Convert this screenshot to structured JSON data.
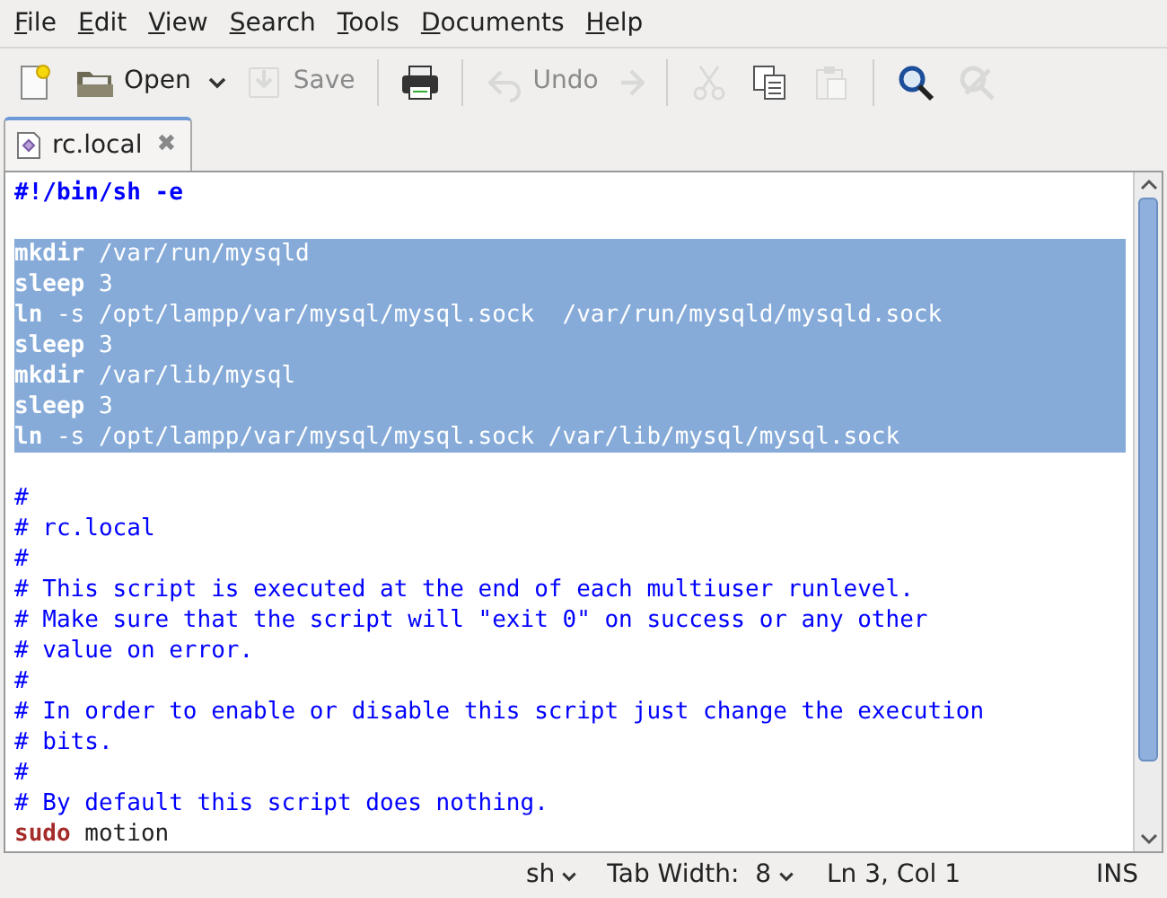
{
  "menu": [
    {
      "label": "File"
    },
    {
      "label": "Edit"
    },
    {
      "label": "View"
    },
    {
      "label": "Search"
    },
    {
      "label": "Tools"
    },
    {
      "label": "Documents"
    },
    {
      "label": "Help"
    }
  ],
  "toolbar": [
    {
      "kind": "new",
      "disabled": false
    },
    {
      "kind": "open",
      "label": "Open",
      "disabled": false
    },
    {
      "kind": "dropdown",
      "disabled": false
    },
    {
      "kind": "save",
      "label": "Save",
      "disabled": true
    },
    {
      "kind": "separator"
    },
    {
      "kind": "print",
      "disabled": false
    },
    {
      "kind": "separator"
    },
    {
      "kind": "undo",
      "label": "Undo",
      "disabled": true
    },
    {
      "kind": "redo",
      "disabled": true
    },
    {
      "kind": "separator"
    },
    {
      "kind": "cut",
      "disabled": true
    },
    {
      "kind": "copy",
      "disabled": false
    },
    {
      "kind": "paste",
      "disabled": true
    },
    {
      "kind": "separator"
    },
    {
      "kind": "find",
      "disabled": false
    },
    {
      "kind": "replace",
      "disabled": true
    }
  ],
  "tabs": [
    {
      "label": "rc.local",
      "selected": true,
      "close": "✖"
    }
  ],
  "editor": {
    "lines": [
      {
        "selected": false,
        "tokens": [
          {
            "text": "#!/bin/sh -e",
            "kind": "shebang"
          }
        ]
      },
      {
        "selected": false
      },
      {
        "selected": true,
        "tokens": [
          {
            "text": "mkdir",
            "kind": "keyword"
          },
          {
            "text": " /var/run/mysqld",
            "kind": "plain"
          }
        ]
      },
      {
        "selected": true,
        "tokens": [
          {
            "text": "sleep",
            "kind": "keyword"
          },
          {
            "text": " 3",
            "kind": "plain"
          }
        ]
      },
      {
        "selected": true,
        "tokens": [
          {
            "text": "ln",
            "kind": "keyword"
          },
          {
            "text": " -s /opt/lampp/var/mysql/mysql.sock  /var/run/mysqld/mysqld.sock",
            "kind": "plain"
          }
        ]
      },
      {
        "selected": true,
        "tokens": [
          {
            "text": "sleep",
            "kind": "keyword"
          },
          {
            "text": " 3",
            "kind": "plain"
          }
        ]
      },
      {
        "selected": true,
        "tokens": [
          {
            "text": "mkdir",
            "kind": "keyword"
          },
          {
            "text": " /var/lib/mysql",
            "kind": "plain"
          }
        ]
      },
      {
        "selected": true,
        "tokens": [
          {
            "text": "sleep",
            "kind": "keyword"
          },
          {
            "text": " 3",
            "kind": "plain"
          }
        ]
      },
      {
        "selected": true,
        "tokens": [
          {
            "text": "ln",
            "kind": "keyword"
          },
          {
            "text": " -s /opt/lampp/var/mysql/mysql.sock /var/lib/mysql/mysql.sock",
            "kind": "plain"
          }
        ]
      },
      {
        "selected": false
      },
      {
        "selected": false,
        "tokens": [
          {
            "text": "#",
            "kind": "comment"
          }
        ]
      },
      {
        "selected": false,
        "tokens": [
          {
            "text": "# rc.local",
            "kind": "comment"
          }
        ]
      },
      {
        "selected": false,
        "tokens": [
          {
            "text": "#",
            "kind": "comment"
          }
        ]
      },
      {
        "selected": false,
        "tokens": [
          {
            "text": "# This script is executed at the end of each multiuser runlevel.",
            "kind": "comment"
          }
        ]
      },
      {
        "selected": false,
        "tokens": [
          {
            "text": "# Make sure that the script will \"exit 0\" on success or any other",
            "kind": "comment"
          }
        ]
      },
      {
        "selected": false,
        "tokens": [
          {
            "text": "# value on error.",
            "kind": "comment"
          }
        ]
      },
      {
        "selected": false,
        "tokens": [
          {
            "text": "#",
            "kind": "comment"
          }
        ]
      },
      {
        "selected": false,
        "tokens": [
          {
            "text": "# In order to enable or disable this script just change the execution",
            "kind": "comment"
          }
        ]
      },
      {
        "selected": false,
        "tokens": [
          {
            "text": "# bits.",
            "kind": "comment"
          }
        ]
      },
      {
        "selected": false,
        "tokens": [
          {
            "text": "#",
            "kind": "comment"
          }
        ]
      },
      {
        "selected": false,
        "tokens": [
          {
            "text": "# By default this script does nothing.",
            "kind": "comment"
          }
        ]
      },
      {
        "selected": false,
        "tokens": [
          {
            "text": "sudo",
            "kind": "keyword"
          },
          {
            "text": " motion",
            "kind": "plain"
          }
        ]
      }
    ]
  },
  "status_bar": {
    "language": "sh",
    "tab_width": "Tab Width:  8",
    "position": "Ln 3, Col 1",
    "mode": "INS"
  }
}
